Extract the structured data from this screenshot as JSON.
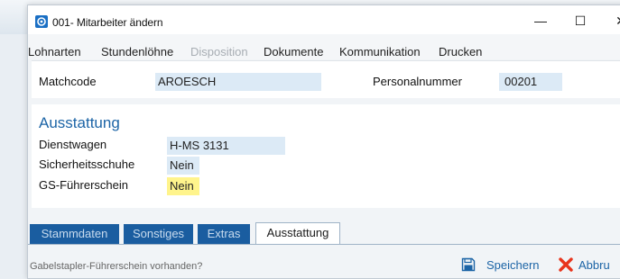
{
  "window": {
    "title": "001- Mitarbeiter ändern"
  },
  "window_controls": {
    "minimize": "—",
    "maximize": "☐",
    "close": "✕"
  },
  "menu": [
    {
      "label": "Lohnarten",
      "disabled": false
    },
    {
      "label": "Stundenlöhne",
      "disabled": false
    },
    {
      "label": "Disposition",
      "disabled": true
    },
    {
      "label": "Dokumente",
      "disabled": false
    },
    {
      "label": "Kommunikation",
      "disabled": false
    },
    {
      "label": "Drucken",
      "disabled": false
    }
  ],
  "header_fields": {
    "matchcode_label": "Matchcode",
    "matchcode_value": "AROESCH",
    "personalnummer_label": "Personalnummer",
    "personalnummer_value": "00201"
  },
  "section": {
    "title": "Ausstattung",
    "rows": [
      {
        "label": "Dienstwagen",
        "value": "H-MS 3131",
        "highlight": false
      },
      {
        "label": "Sicherheitsschuhe",
        "value": "Nein",
        "highlight": false
      },
      {
        "label": "GS-Führerschein",
        "value": "Nein",
        "highlight": true
      }
    ]
  },
  "tabs": [
    {
      "label": "Stammdaten",
      "active": false
    },
    {
      "label": "Sonstiges",
      "active": false
    },
    {
      "label": "Extras",
      "active": false
    },
    {
      "label": "Ausstattung",
      "active": true
    }
  ],
  "status": {
    "hint": "Gabelstapler-Führerschein vorhanden?",
    "save_label": "Speichern",
    "cancel_label": "Abbru"
  },
  "colors": {
    "accent": "#1c64a6",
    "tab_bg": "#1a5da0",
    "field_bg": "#dceaf6",
    "highlight": "#fff48c"
  }
}
